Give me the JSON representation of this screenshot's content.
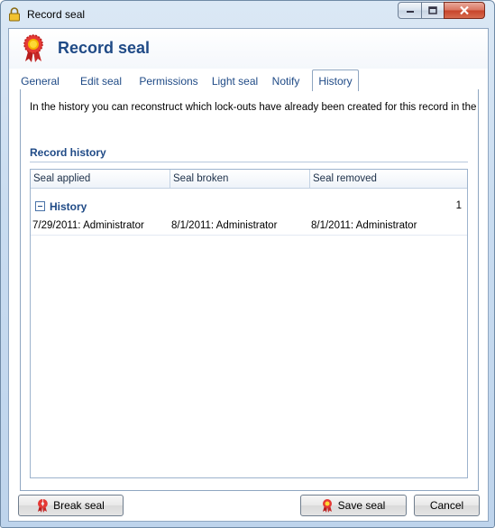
{
  "window": {
    "title": "Record seal",
    "controls": [
      "minimize",
      "maximize",
      "close"
    ]
  },
  "header": {
    "icon": "rosette-seal-icon",
    "title": "Record seal"
  },
  "tabs": [
    {
      "label": "General",
      "active": false
    },
    {
      "label": "Edit seal",
      "active": false
    },
    {
      "label": "Permissions",
      "active": false
    },
    {
      "label": "Light seal",
      "active": false
    },
    {
      "label": "Notify",
      "active": false
    },
    {
      "label": "History",
      "active": true
    }
  ],
  "history": {
    "intro": "In the history you can reconstruct which lock-outs have already been created for this record in the past.",
    "section_title": "Record history",
    "columns": [
      "Seal applied",
      "Seal broken",
      "Seal removed"
    ],
    "group": {
      "label": "History",
      "count": "1"
    },
    "rows": [
      [
        "7/29/2011: Administrator",
        "8/1/2011: Administrator",
        "8/1/2011: Administrator"
      ]
    ]
  },
  "buttons": {
    "break_seal": "Break seal",
    "save_seal": "Save seal",
    "cancel": "Cancel"
  },
  "colors": {
    "accent": "#1f4a86",
    "seal_red": "#d4311f",
    "border": "#8fa6c1"
  }
}
